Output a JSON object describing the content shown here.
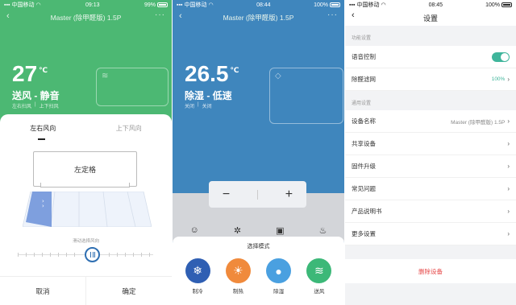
{
  "screens": [
    {
      "status": {
        "carrier": "中国移动",
        "time": "09:13",
        "battery": "99%"
      },
      "title": "Master (除甲醛版) 1.5P",
      "temperature": "27",
      "temp_unit": "℃",
      "mode": "送风 - 静音",
      "sub_left": "左右扫风",
      "sub_right": "上下扫风",
      "tabs": [
        "左右风向",
        "上下风向"
      ],
      "lock_label": "左定格",
      "slider_label": "滑动选择风向",
      "cancel": "取消",
      "confirm": "确定",
      "color": "#4cb873"
    },
    {
      "status": {
        "carrier": "中国移动",
        "time": "08:44",
        "battery": "100%"
      },
      "title": "Master (除甲醛版) 1.5P",
      "temperature": "26.5",
      "temp_unit": "℃",
      "mode": "除湿 - 低速",
      "sub_left": "关闭",
      "sub_right": "关闭",
      "sheet_title": "选择模式",
      "modes": [
        {
          "label": "制冷",
          "icon": "snowflake-icon",
          "color": "#2f5fb3"
        },
        {
          "label": "制热",
          "icon": "sun-icon",
          "color": "#f08a3c"
        },
        {
          "label": "除湿",
          "icon": "droplet-icon",
          "color": "#4aa0e0"
        },
        {
          "label": "送风",
          "icon": "wind-icon",
          "color": "#3cb878"
        }
      ],
      "color": "#3f86bd"
    },
    {
      "status": {
        "carrier": "中国移动",
        "time": "08:45",
        "battery": "100%"
      },
      "title": "设置",
      "section1": "功能设置",
      "voice": "语音控制",
      "filter": "除醛滤网",
      "filter_value": "100%",
      "section2": "通用设置",
      "rows": [
        {
          "label": "设备名称",
          "value": "Master (除甲醛版) 1.5P"
        },
        {
          "label": "共享设备",
          "value": ""
        },
        {
          "label": "固件升级",
          "value": ""
        },
        {
          "label": "常见问题",
          "value": ""
        },
        {
          "label": "产品说明书",
          "value": ""
        },
        {
          "label": "更多设置",
          "value": ""
        }
      ],
      "delete": "删除设备",
      "toggle_color": "#3fb59b",
      "danger_color": "#e64a4a"
    }
  ]
}
